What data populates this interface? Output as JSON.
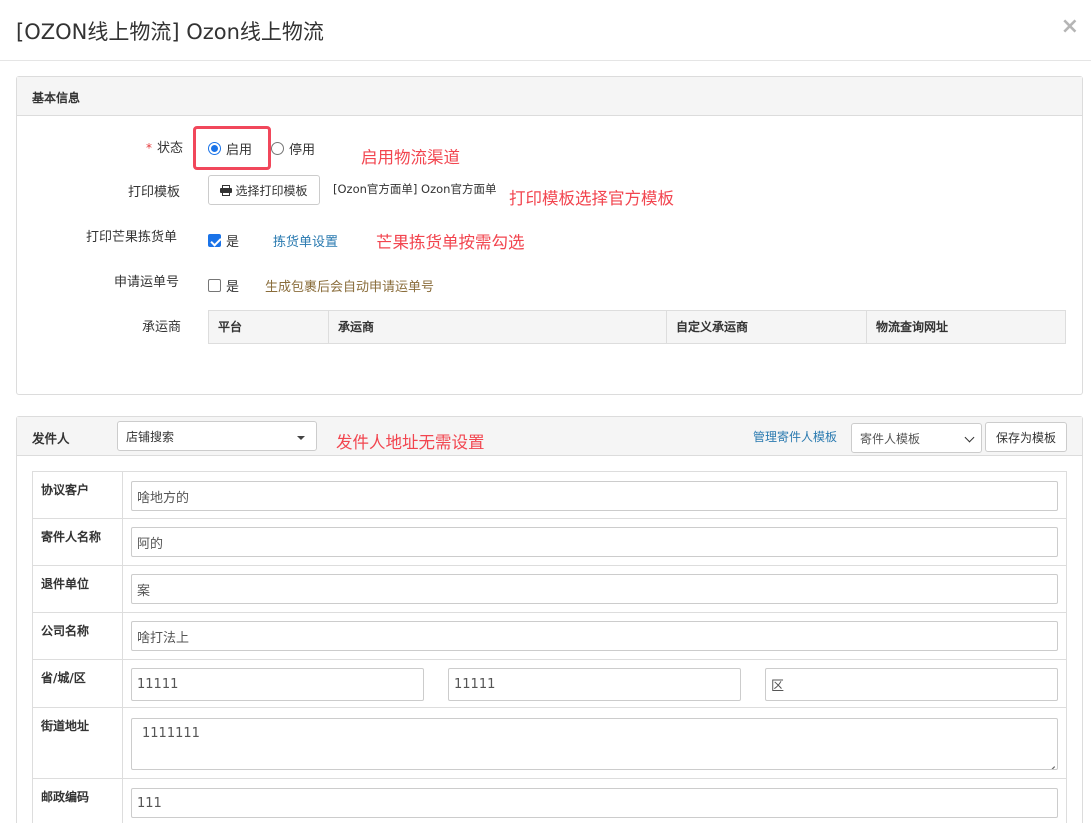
{
  "modal": {
    "title": "[OZON线上物流] Ozon线上物流",
    "close_icon": "×"
  },
  "basic": {
    "heading": "基本信息",
    "status": {
      "required_mark": "*",
      "label": "状态",
      "options": [
        "启用",
        "停用"
      ],
      "selected": "启用",
      "annotation": "启用物流渠道"
    },
    "print_template": {
      "label": "打印模板",
      "button_label": "选择打印模板",
      "selected_text": "[Ozon官方面单] Ozon官方面单",
      "annotation": "打印模板选择官方模板"
    },
    "mango_picking": {
      "label": "打印芒果拣货单",
      "checkbox_label": "是",
      "checked": true,
      "settings_link": "拣货单设置",
      "annotation": "芒果拣货单按需勾选"
    },
    "apply_tracking": {
      "label": "申请运单号",
      "checkbox_label": "是",
      "checked": false,
      "hint": "生成包裹后会自动申请运单号"
    },
    "carrier": {
      "label": "承运商",
      "columns": [
        "平台",
        "承运商",
        "自定义承运商",
        "物流查询网址"
      ]
    }
  },
  "sender": {
    "heading": "发件人",
    "store_search": "店铺搜索",
    "annotation": "发件人地址无需设置",
    "manage_link": "管理寄件人模板",
    "template_select": "寄件人模板",
    "save_button": "保存为模板",
    "rows": {
      "agreement_customer": {
        "label": "协议客户",
        "value": "啥地方的"
      },
      "sender_name": {
        "label": "寄件人名称",
        "value": "阿的"
      },
      "return_unit": {
        "label": "退件单位",
        "value": "案"
      },
      "company_name": {
        "label": "公司名称",
        "value": "啥打法上"
      },
      "region": {
        "label": "省/城/区",
        "province": "11111",
        "city": "11111",
        "district": "区"
      },
      "street": {
        "label": "街道地址",
        "value": "1111111"
      },
      "postal": {
        "label": "邮政编码",
        "value": "111"
      }
    }
  },
  "colors": {
    "annotation": "#f2454f",
    "highlight_border": "#f1475b",
    "link": "#2a7ab0",
    "hint": "#8a6d3b",
    "radio_checked": "#1a73e8"
  }
}
